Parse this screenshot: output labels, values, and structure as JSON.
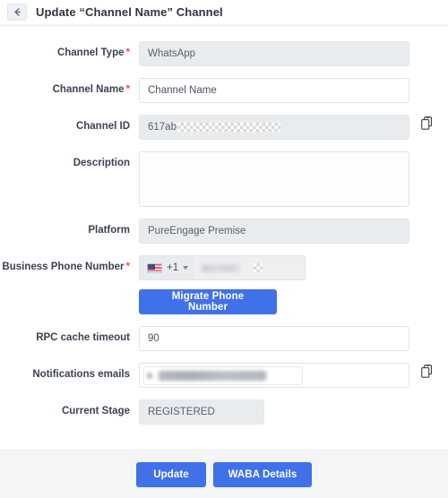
{
  "header": {
    "back_icon": "arrow-left-icon",
    "title": "Update “Channel Name” Channel"
  },
  "form": {
    "fields": [
      {
        "label": "Channel Type",
        "required": true,
        "value": "WhatsApp",
        "state": "disabled",
        "type": "text"
      },
      {
        "label": "Channel Name",
        "required": true,
        "value": "Channel Name",
        "state": "editable",
        "type": "text"
      },
      {
        "label": "Channel ID",
        "required": false,
        "value": "617ab",
        "state": "disabled",
        "type": "text-redacted",
        "copy_icon": "copy-icon"
      },
      {
        "label": "Description",
        "required": false,
        "value": "",
        "state": "editable",
        "type": "textarea"
      },
      {
        "label": "Platform",
        "required": false,
        "value": "PureEngage Premise",
        "state": "disabled",
        "type": "text"
      },
      {
        "label": "Business Phone Number",
        "required": true,
        "value": "",
        "state": "disabled",
        "type": "phone",
        "country_flag": "us-flag-icon",
        "country_code": "+1",
        "caret_icon": "chevron-down-icon"
      },
      {
        "label": "",
        "required": false,
        "value": "Migrate Phone Number",
        "state": "editable",
        "type": "button"
      },
      {
        "label": "RPC cache timeout",
        "required": false,
        "value": "90",
        "state": "editable",
        "type": "text"
      },
      {
        "label": "Notifications emails",
        "required": false,
        "value": "",
        "state": "editable",
        "type": "email-redacted",
        "copy_icon": "copy-icon"
      },
      {
        "label": "Current Stage",
        "required": false,
        "value": "REGISTERED",
        "state": "disabled",
        "type": "text-narrow"
      }
    ],
    "required_marker": "*"
  },
  "footer": {
    "update_label": "Update",
    "waba_label": "WABA Details"
  },
  "colors": {
    "primary_blue": "#4071e8",
    "required_red": "#f2495c",
    "disabled_bg": "#e9ecef",
    "footer_bg": "#f4f5f6",
    "label_text": "#3b4251"
  }
}
